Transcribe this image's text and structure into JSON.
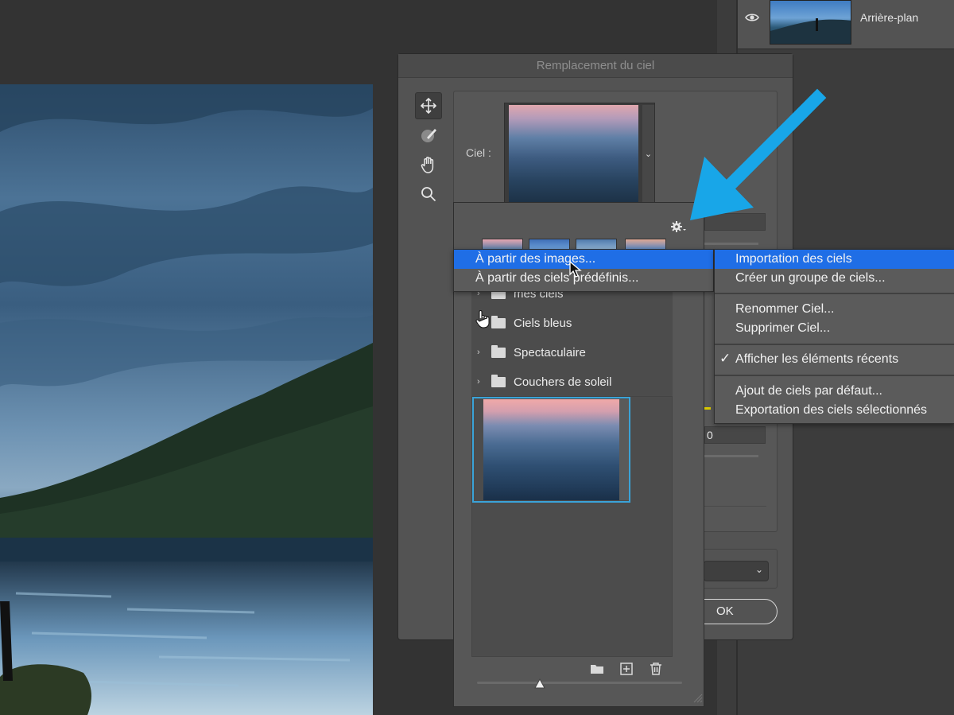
{
  "dialog": {
    "title": "Remplacement du ciel",
    "sky_label": "Ciel :",
    "ok_label": "OK",
    "value_field": "0"
  },
  "layers": {
    "layer_name": "Arrière-plan"
  },
  "sky_picker": {
    "folders": [
      {
        "name": "mes ciels"
      },
      {
        "name": "Ciels bleus"
      },
      {
        "name": "Spectaculaire"
      },
      {
        "name": "Couchers de soleil"
      }
    ]
  },
  "context_menu_left": {
    "items": [
      "À partir des images...",
      "À partir des ciels prédéfinis..."
    ]
  },
  "context_menu_right": {
    "items": [
      "Importation des ciels",
      "Créer un groupe de ciels...",
      "Renommer Ciel...",
      "Supprimer Ciel...",
      "Afficher les éléments récents",
      "Ajout de ciels par défaut...",
      "Exportation des ciels sélectionnés"
    ],
    "checkmark": "✓"
  },
  "colors": {
    "accent_highlight": "#1f6ee6",
    "selection_border": "#3aa3d8",
    "annotation_arrow": "#18a6e8"
  }
}
